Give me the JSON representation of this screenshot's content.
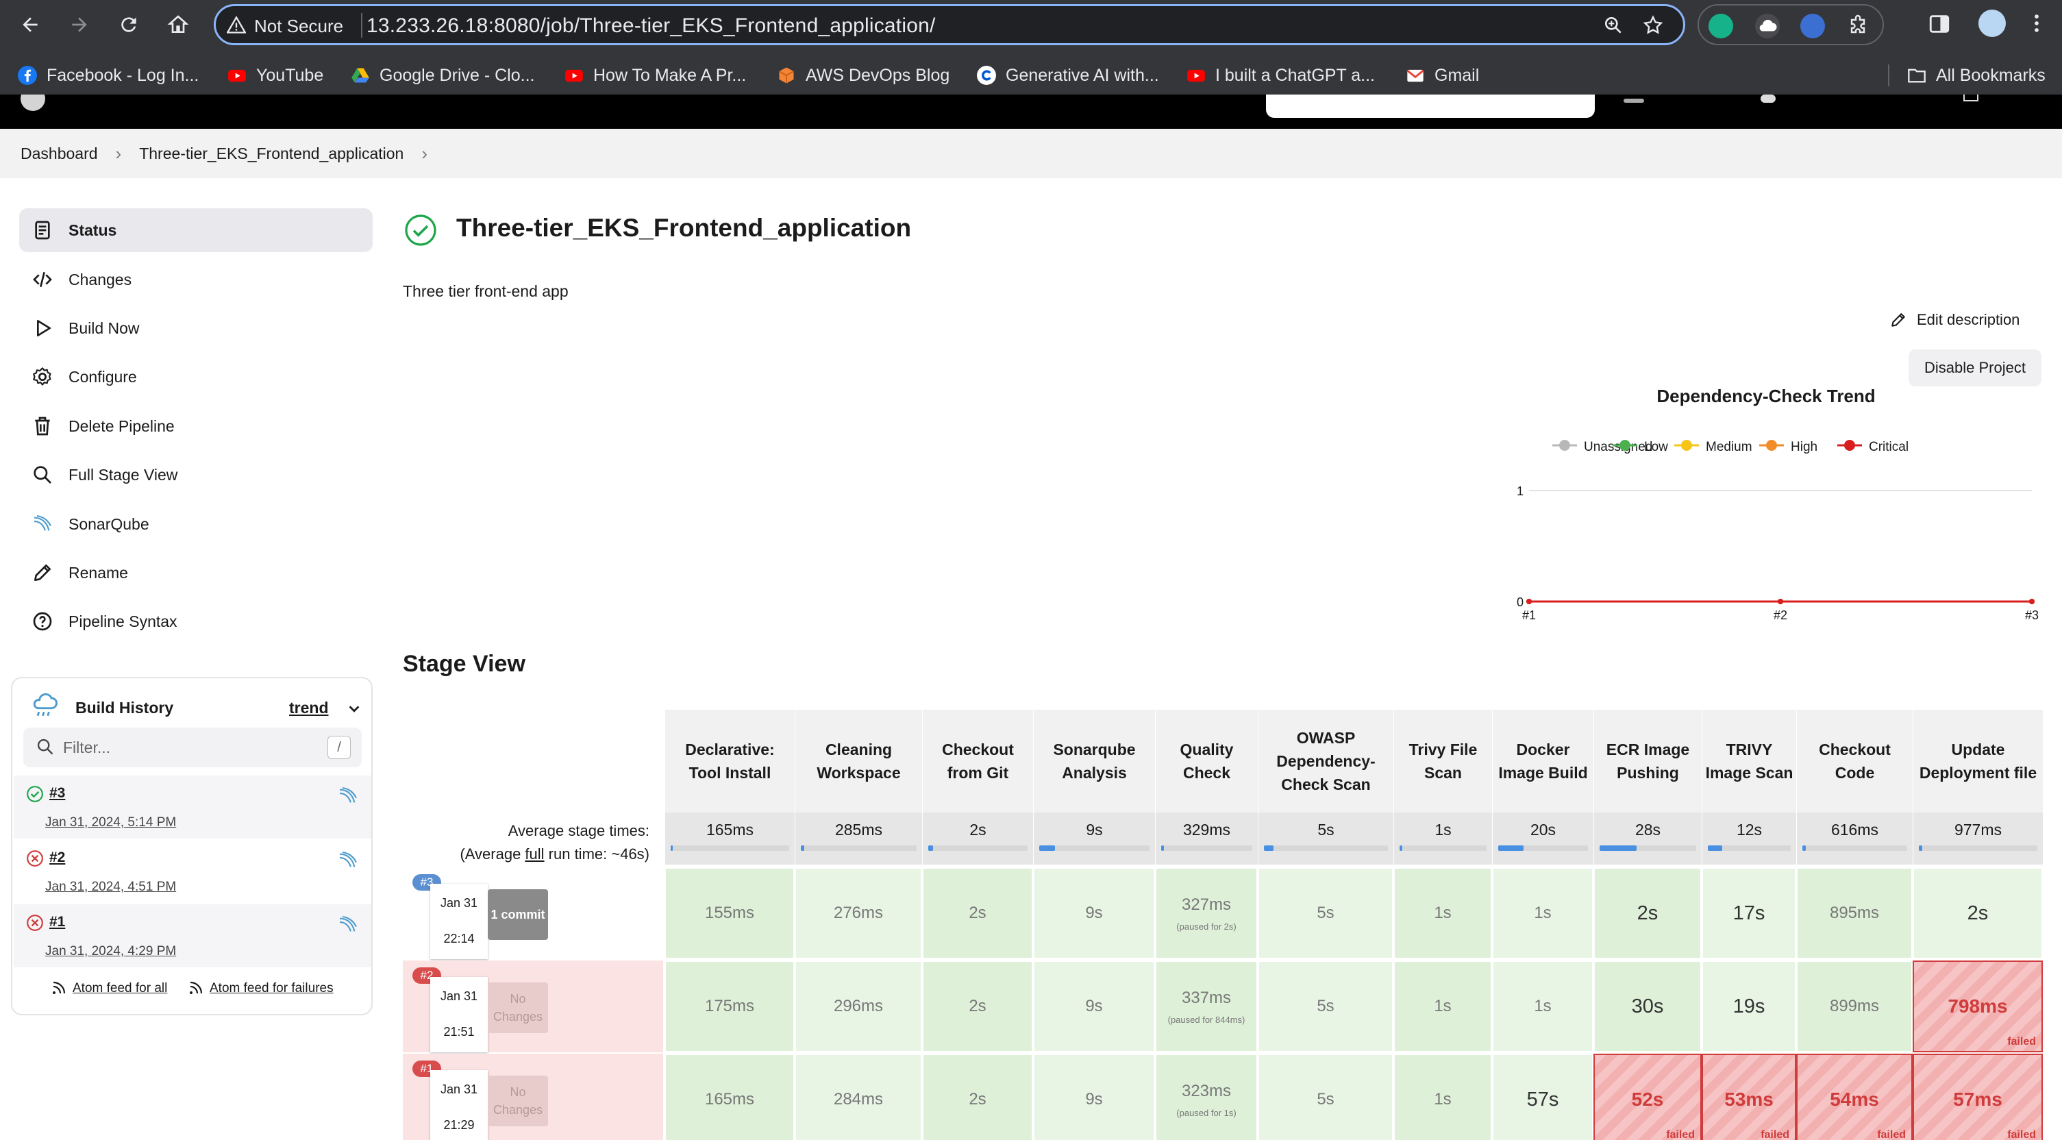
{
  "browser": {
    "security_label": "Not Secure",
    "url": "13.233.26.18:8080/job/Three-tier_EKS_Frontend_application/",
    "bookmarks": [
      {
        "label": "Facebook - Log In..."
      },
      {
        "label": "YouTube"
      },
      {
        "label": "Google Drive - Clo..."
      },
      {
        "label": "How To Make A Pr..."
      },
      {
        "label": "AWS DevOps Blog"
      },
      {
        "label": "Generative AI with..."
      },
      {
        "label": "I built a ChatGPT a..."
      },
      {
        "label": "Gmail"
      }
    ],
    "all_bookmarks": "All Bookmarks"
  },
  "breadcrumb": {
    "items": [
      "Dashboard",
      "Three-tier_EKS_Frontend_application"
    ]
  },
  "sidebar": {
    "items": [
      {
        "label": "Status",
        "icon": "document-icon"
      },
      {
        "label": "Changes",
        "icon": "code-icon"
      },
      {
        "label": "Build Now",
        "icon": "play-icon"
      },
      {
        "label": "Configure",
        "icon": "gear-icon"
      },
      {
        "label": "Delete Pipeline",
        "icon": "trash-icon"
      },
      {
        "label": "Full Stage View",
        "icon": "search-icon"
      },
      {
        "label": "SonarQube",
        "icon": "sonarqube-icon"
      },
      {
        "label": "Rename",
        "icon": "pencil-icon"
      },
      {
        "label": "Pipeline Syntax",
        "icon": "help-icon"
      }
    ]
  },
  "build_history": {
    "title": "Build History",
    "trend": "trend",
    "filter_placeholder": "Filter...",
    "filter_shortcut": "/",
    "builds": [
      {
        "number": "#3",
        "date": "Jan 31, 2024, 5:14 PM",
        "status": "success"
      },
      {
        "number": "#2",
        "date": "Jan 31, 2024, 4:51 PM",
        "status": "failed"
      },
      {
        "number": "#1",
        "date": "Jan 31, 2024, 4:29 PM",
        "status": "failed"
      }
    ],
    "feed_all": "Atom feed for all",
    "feed_failures": "Atom feed for failures"
  },
  "job": {
    "title": "Three-tier_EKS_Frontend_application",
    "description": "Three tier front-end app",
    "edit_description": "Edit description",
    "disable_project": "Disable Project"
  },
  "chart_data": {
    "type": "line",
    "title": "Dependency-Check Trend",
    "legend": [
      "Unassigned",
      "Low",
      "Medium",
      "High",
      "Critical"
    ],
    "colors": {
      "Unassigned": "#b8b8b8",
      "Low": "#4caf50",
      "Medium": "#f5c518",
      "High": "#f28c28",
      "Critical": "#d81e1e"
    },
    "categories": [
      "#1",
      "#2",
      "#3"
    ],
    "series": [
      {
        "name": "Unassigned",
        "values": [
          0,
          0,
          0
        ]
      },
      {
        "name": "Low",
        "values": [
          0,
          0,
          0
        ]
      },
      {
        "name": "Medium",
        "values": [
          0,
          0,
          0
        ]
      },
      {
        "name": "High",
        "values": [
          0,
          0,
          0
        ]
      },
      {
        "name": "Critical",
        "values": [
          0,
          0,
          0
        ]
      }
    ],
    "yticks": [
      "1",
      "0"
    ],
    "ylim": [
      0,
      1
    ],
    "legend_position": "top"
  },
  "stage_view": {
    "title": "Stage View",
    "avg_label": "Average stage times:",
    "avg_full_prefix": "(Average ",
    "avg_full_link": "full",
    "avg_full_suffix": " run time: ~46s)",
    "stages": [
      {
        "name": "Declarative: Tool Install",
        "avg": "165ms",
        "fill": 0.02
      },
      {
        "name": "Cleaning Workspace",
        "avg": "285ms",
        "fill": 0.03
      },
      {
        "name": "Checkout from Git",
        "avg": "2s",
        "fill": 0.05
      },
      {
        "name": "Sonarqube Analysis",
        "avg": "9s",
        "fill": 0.14
      },
      {
        "name": "Quality Check",
        "avg": "329ms",
        "fill": 0.03
      },
      {
        "name": "OWASP Dependency-Check Scan",
        "avg": "5s",
        "fill": 0.08
      },
      {
        "name": "Trivy File Scan",
        "avg": "1s",
        "fill": 0.03
      },
      {
        "name": "Docker Image Build",
        "avg": "20s",
        "fill": 0.28
      },
      {
        "name": "ECR Image Pushing",
        "avg": "28s",
        "fill": 0.38
      },
      {
        "name": "TRIVY Image Scan",
        "avg": "12s",
        "fill": 0.17
      },
      {
        "name": "Checkout Code",
        "avg": "616ms",
        "fill": 0.03
      },
      {
        "name": "Update Deployment file",
        "avg": "977ms",
        "fill": 0.03
      }
    ],
    "runs": [
      {
        "badge": "#3",
        "date": "Jan 31",
        "time": "22:14",
        "changes": "1 commit",
        "cells": [
          "155ms",
          "276ms",
          "2s",
          "9s",
          "327ms",
          "5s",
          "1s",
          "1s",
          "2s",
          "17s",
          "895ms",
          "2s"
        ],
        "paused": "(paused for 2s)",
        "failed": [
          false,
          false,
          false,
          false,
          false,
          false,
          false,
          false,
          false,
          false,
          false,
          false
        ]
      },
      {
        "badge": "#2",
        "date": "Jan 31",
        "time": "21:51",
        "changes": "No Changes",
        "cells": [
          "175ms",
          "296ms",
          "2s",
          "9s",
          "337ms",
          "5s",
          "1s",
          "1s",
          "30s",
          "19s",
          "899ms",
          "798ms"
        ],
        "paused": "(paused for 844ms)",
        "failed": [
          false,
          false,
          false,
          false,
          false,
          false,
          false,
          false,
          false,
          false,
          false,
          true
        ]
      },
      {
        "badge": "#1",
        "date": "Jan 31",
        "time": "21:29",
        "changes": "No Changes",
        "cells": [
          "165ms",
          "284ms",
          "2s",
          "9s",
          "323ms",
          "5s",
          "1s",
          "57s",
          "52s",
          "53ms",
          "54ms",
          "57ms"
        ],
        "paused": "(paused for 1s)",
        "failed": [
          false,
          false,
          false,
          false,
          false,
          false,
          false,
          false,
          true,
          true,
          true,
          true
        ]
      }
    ],
    "failed_label": "failed"
  }
}
